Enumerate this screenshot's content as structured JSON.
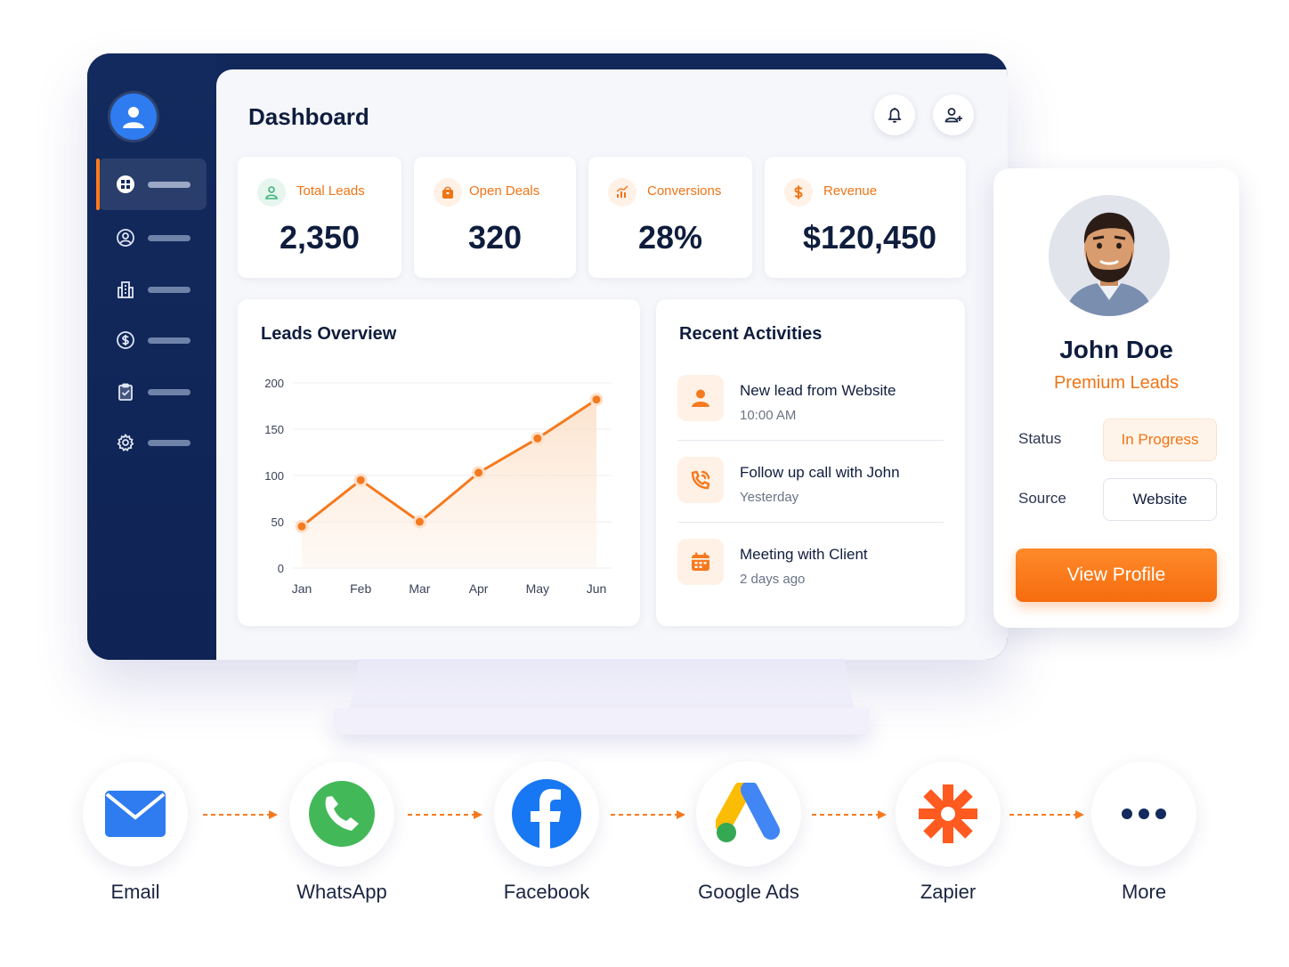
{
  "dashboard": {
    "title": "Dashboard"
  },
  "sidebar": {
    "items": [
      {
        "icon": "grid-icon",
        "active": true
      },
      {
        "icon": "user-circle-icon",
        "active": false
      },
      {
        "icon": "building-icon",
        "active": false
      },
      {
        "icon": "dollar-circle-icon",
        "active": false
      },
      {
        "icon": "clipboard-check-icon",
        "active": false
      },
      {
        "icon": "gear-icon",
        "active": false
      }
    ]
  },
  "stats": [
    {
      "label": "Total Leads",
      "value": "2,350",
      "icon": "user-icon",
      "icon_color": "#3fb27a"
    },
    {
      "label": "Open Deals",
      "value": "320",
      "icon": "bag-icon",
      "icon_color": "#f07416"
    },
    {
      "label": "Conversions",
      "value": "28%",
      "icon": "bar-chart-icon",
      "icon_color": "#f07416"
    },
    {
      "label": "Revenue",
      "value": "$120,450",
      "icon": "dollar-icon",
      "icon_color": "#f07416"
    }
  ],
  "leads_overview": {
    "title": "Leads Overview"
  },
  "chart_data": {
    "type": "area",
    "title": "Leads Overview",
    "categories": [
      "Jan",
      "Feb",
      "Mar",
      "Apr",
      "May",
      "Jun"
    ],
    "values": [
      45,
      95,
      50,
      103,
      140,
      182
    ],
    "yticks": [
      "200",
      "150",
      "100",
      "50",
      "0"
    ],
    "ylim": [
      0,
      200
    ],
    "grid": true,
    "color": "#f57a1f"
  },
  "recent_activities": {
    "title": "Recent Activities",
    "items": [
      {
        "title": "New lead from Website",
        "time": "10:00 AM",
        "icon": "user-icon"
      },
      {
        "title": "Follow up call with John",
        "time": "Yesterday",
        "icon": "phone-icon"
      },
      {
        "title": "Meeting with Client",
        "time": "2 days ago",
        "icon": "calendar-icon"
      }
    ]
  },
  "profile": {
    "name": "John Doe",
    "role": "Premium Leads",
    "status_label": "Status",
    "status_value": "In Progress",
    "source_label": "Source",
    "source_value": "Website",
    "button": "View Profile"
  },
  "integrations": [
    {
      "label": "Email",
      "icon": "email-icon"
    },
    {
      "label": "WhatsApp",
      "icon": "whatsapp-icon"
    },
    {
      "label": "Facebook",
      "icon": "facebook-icon"
    },
    {
      "label": "Google Ads",
      "icon": "google-ads-icon"
    },
    {
      "label": "Zapier",
      "icon": "zapier-icon"
    },
    {
      "label": "More",
      "icon": "more-icon"
    }
  ],
  "colors": {
    "accent": "#f57a1f",
    "navy": "#12275a",
    "status_bg": "#fff4ea"
  }
}
